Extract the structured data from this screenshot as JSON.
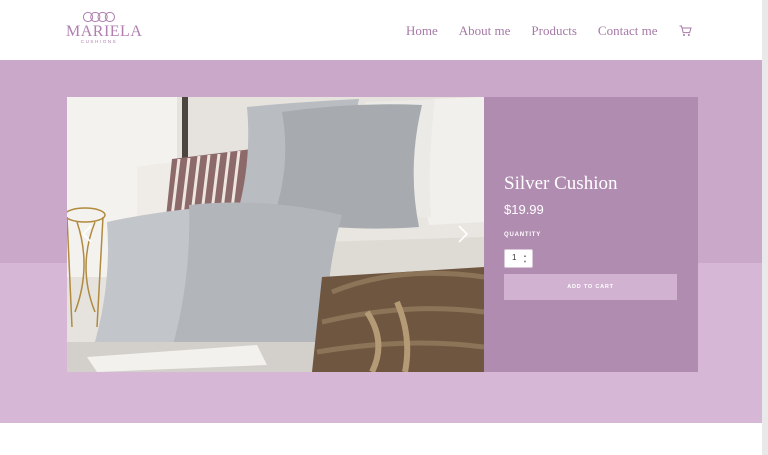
{
  "brand": {
    "name": "MARIELA",
    "tagline": "CUSHIONS",
    "color": "#b07fb0"
  },
  "nav": {
    "items": [
      {
        "label": "Home"
      },
      {
        "label": "About me"
      },
      {
        "label": "Products"
      },
      {
        "label": "Contact me"
      }
    ],
    "cart_icon": "cart-icon"
  },
  "product": {
    "title": "Silver Cushion",
    "price": "$19.99",
    "quantity_label": "QUANTITY",
    "quantity_value": "1",
    "add_to_cart_label": "ADD TO CART"
  },
  "gallery": {
    "prev_icon": "chevron-left-icon",
    "next_icon": "chevron-right-icon"
  },
  "colors": {
    "band_top": "#c9a8c9",
    "band_bottom": "#d6b8d6",
    "panel": "#b08cb0",
    "button": "#d1b3d1",
    "nav_text": "#a679a6"
  }
}
